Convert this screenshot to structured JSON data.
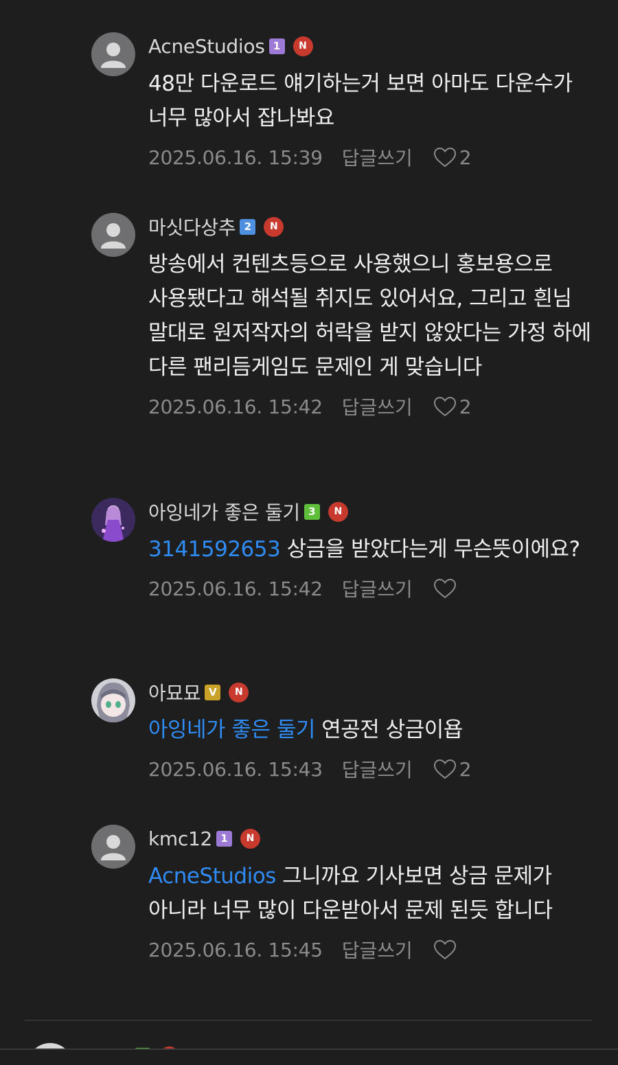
{
  "colors": {
    "background": "#1e1e1f",
    "mention": "#2f8cf5",
    "new_badge": "#c8392e",
    "meta_text": "#8b8b8b"
  },
  "comments": [
    {
      "username": "AcneStudios",
      "level": "1",
      "level_color": "#9c7ad6",
      "new_badge": "N",
      "avatar": "default-avatar-icon",
      "mention": "",
      "text": "48만 다운로드 얘기하는거 보면 아마도 다운수가 너무 많아서 잡나봐요",
      "timestamp": "2025.06.16. 15:39",
      "reply_label": "답글쓰기",
      "likes": "2"
    },
    {
      "username": "마싯다상추",
      "level": "2",
      "level_color": "#4f8fe0",
      "new_badge": "N",
      "avatar": "default-avatar-icon",
      "mention": "",
      "text": "방송에서 컨텐츠등으로 사용했으니 홍보용으로 사용됐다고 해석될 취지도 있어서요, 그리고 흰님 말대로 원저작자의 허락을 받지 않았다는 가정 하에 다른 팬리듬게임도 문제인 게 맞습니다",
      "timestamp": "2025.06.16. 15:42",
      "reply_label": "답글쓰기",
      "likes": "2"
    },
    {
      "username": "아잉네가 좋은 둘기",
      "level": "3",
      "level_color": "#5fbf3a",
      "new_badge": "N",
      "avatar": "anime-profile-avatar",
      "mention": "3141592653",
      "text": "상금을 받았다는게 무슨뜻이에요?",
      "timestamp": "2025.06.16. 15:42",
      "reply_label": "답글쓰기",
      "likes": ""
    },
    {
      "username": "아묘묘",
      "level": "V",
      "level_color": "#c9a227",
      "new_badge": "N",
      "avatar": "anime-girl-avatar",
      "mention": "아잉네가 좋은 둘기",
      "text": "연공전 상금이욥",
      "timestamp": "2025.06.16. 15:43",
      "reply_label": "답글쓰기",
      "likes": "2"
    },
    {
      "username": "kmc12",
      "level": "1",
      "level_color": "#9c7ad6",
      "new_badge": "N",
      "avatar": "default-avatar-icon",
      "mention": "AcneStudios",
      "text": "그니까요 기사보면 상금 문제가 아니라 너무 많이 다운받아서 문제 된듯 합니다",
      "timestamp": "2025.06.16. 15:45",
      "reply_label": "답글쓰기",
      "likes": ""
    }
  ]
}
